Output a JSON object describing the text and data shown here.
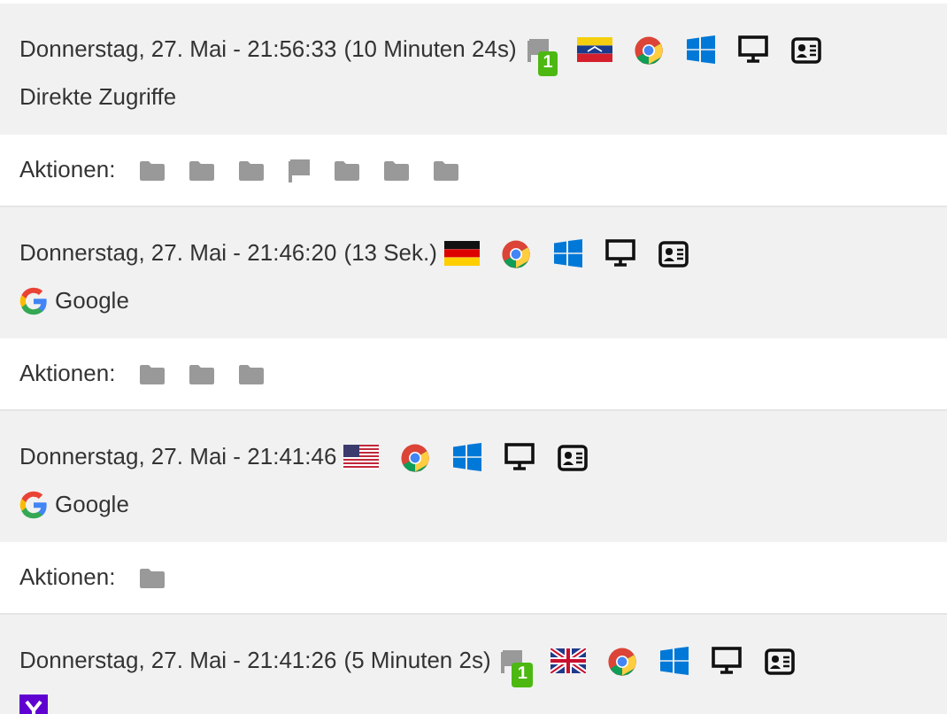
{
  "visits": [
    {
      "time": "Donnerstag, 27. Mai - 21:56:33",
      "duration": "(10 Minuten 24s)",
      "flag_badge": "1",
      "country_flag": {
        "kind": "ve"
      },
      "source": {
        "kind": "direct",
        "label": "Direkte Zugriffe"
      },
      "actions_label": "Aktionen:",
      "actions": [
        {
          "kind": "folder"
        },
        {
          "kind": "folder"
        },
        {
          "kind": "folder"
        },
        {
          "kind": "flag"
        },
        {
          "kind": "folder"
        },
        {
          "kind": "folder"
        },
        {
          "kind": "folder"
        }
      ]
    },
    {
      "time": "Donnerstag, 27. Mai - 21:46:20",
      "duration": "(13 Sek.)",
      "country_flag": {
        "kind": "de"
      },
      "source": {
        "kind": "google",
        "label": "Google"
      },
      "actions_label": "Aktionen:",
      "actions": [
        {
          "kind": "folder"
        },
        {
          "kind": "folder"
        },
        {
          "kind": "folder"
        }
      ]
    },
    {
      "time": "Donnerstag, 27. Mai - 21:41:46",
      "country_flag": {
        "kind": "us"
      },
      "source": {
        "kind": "google",
        "label": "Google"
      },
      "actions_label": "Aktionen:",
      "actions": [
        {
          "kind": "folder"
        }
      ]
    },
    {
      "time": "Donnerstag, 27. Mai - 21:41:26",
      "duration": "(5 Minuten 2s)",
      "flag_badge": "1",
      "country_flag": {
        "kind": "gb"
      },
      "source": {
        "kind": "yahoo"
      }
    }
  ]
}
